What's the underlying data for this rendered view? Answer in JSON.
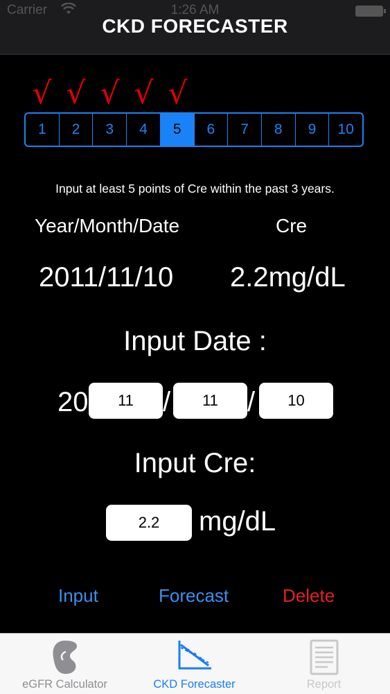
{
  "status_bar": {
    "carrier": "Carrier",
    "time": "1:26 AM"
  },
  "nav": {
    "title": "CKD FORECASTER"
  },
  "points": {
    "checkmark": "√",
    "checked": [
      1,
      2,
      3,
      4,
      5
    ],
    "labels": [
      "1",
      "2",
      "3",
      "4",
      "5",
      "6",
      "7",
      "8",
      "9",
      "10"
    ],
    "selected": "5"
  },
  "instruction": "Input at least 5 points of Cre within the past 3 years.",
  "headers": {
    "date": "Year/Month/Date",
    "cre": "Cre"
  },
  "current": {
    "date": "2011/11/10",
    "cre": "2.2mg/dL"
  },
  "input_date": {
    "label": "Input Date :",
    "prefix": "20",
    "separator": "/",
    "year": "11",
    "month": "11",
    "day": "10"
  },
  "input_cre": {
    "label": "Input Cre:",
    "value": "2.2",
    "unit": "mg/dL"
  },
  "actions": {
    "input": "Input",
    "forecast": "Forecast",
    "delete": "Delete"
  },
  "tabs": [
    {
      "label": "eGFR Calculator",
      "icon": "kidney-icon"
    },
    {
      "label": "CKD Forecaster",
      "icon": "graph-icon",
      "active": true
    },
    {
      "label": "Report",
      "icon": "report-icon"
    }
  ],
  "colors": {
    "accent": "#1a82f7",
    "check": "#e00000",
    "delete": "#e62020"
  }
}
